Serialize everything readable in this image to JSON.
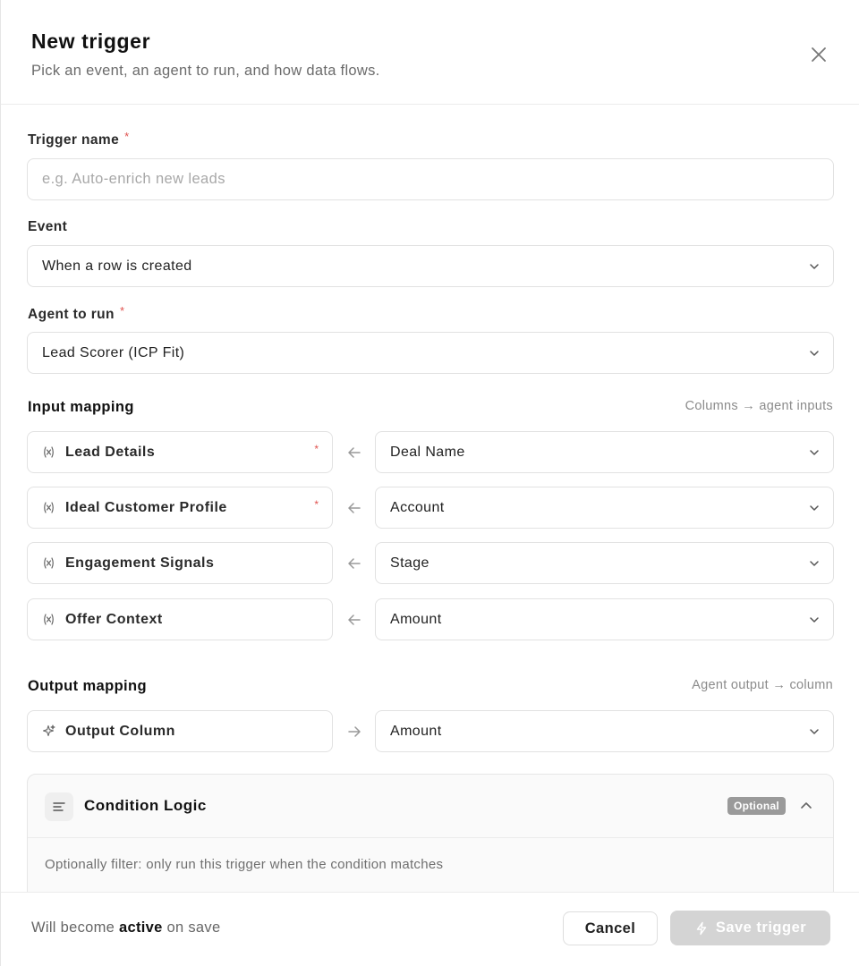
{
  "header": {
    "title": "New trigger",
    "subtitle": "Pick an event, an agent to run, and how data flows."
  },
  "form": {
    "trigger_name": {
      "label": "Trigger name",
      "required_mark": "*",
      "value": "",
      "placeholder": "e.g. Auto-enrich new leads"
    },
    "event": {
      "label": "Event",
      "selected": "When a row is created"
    },
    "agent": {
      "label": "Agent to run",
      "required_mark": "*",
      "selected": "Lead Scorer (ICP Fit)"
    }
  },
  "input_mapping": {
    "title": "Input mapping",
    "hint": "Columns → agent inputs",
    "rows": [
      {
        "input": "Lead Details",
        "required_mark": "*",
        "column": "Deal Name"
      },
      {
        "input": "Ideal Customer Profile",
        "required_mark": "*",
        "column": "Account"
      },
      {
        "input": "Engagement Signals",
        "required_mark": "",
        "column": "Stage"
      },
      {
        "input": "Offer Context",
        "required_mark": "",
        "column": "Amount"
      }
    ]
  },
  "output_mapping": {
    "title": "Output mapping",
    "hint": "Agent output → column",
    "output": "Output Column",
    "column": "Amount"
  },
  "condition": {
    "title": "Condition Logic",
    "badge": "Optional",
    "description": "Optionally filter: only run this trigger when the condition matches"
  },
  "footer": {
    "note_prefix": "Will become",
    "note_status": "active",
    "note_suffix": "on save",
    "cancel_label": "Cancel",
    "save_label": "Save trigger"
  }
}
